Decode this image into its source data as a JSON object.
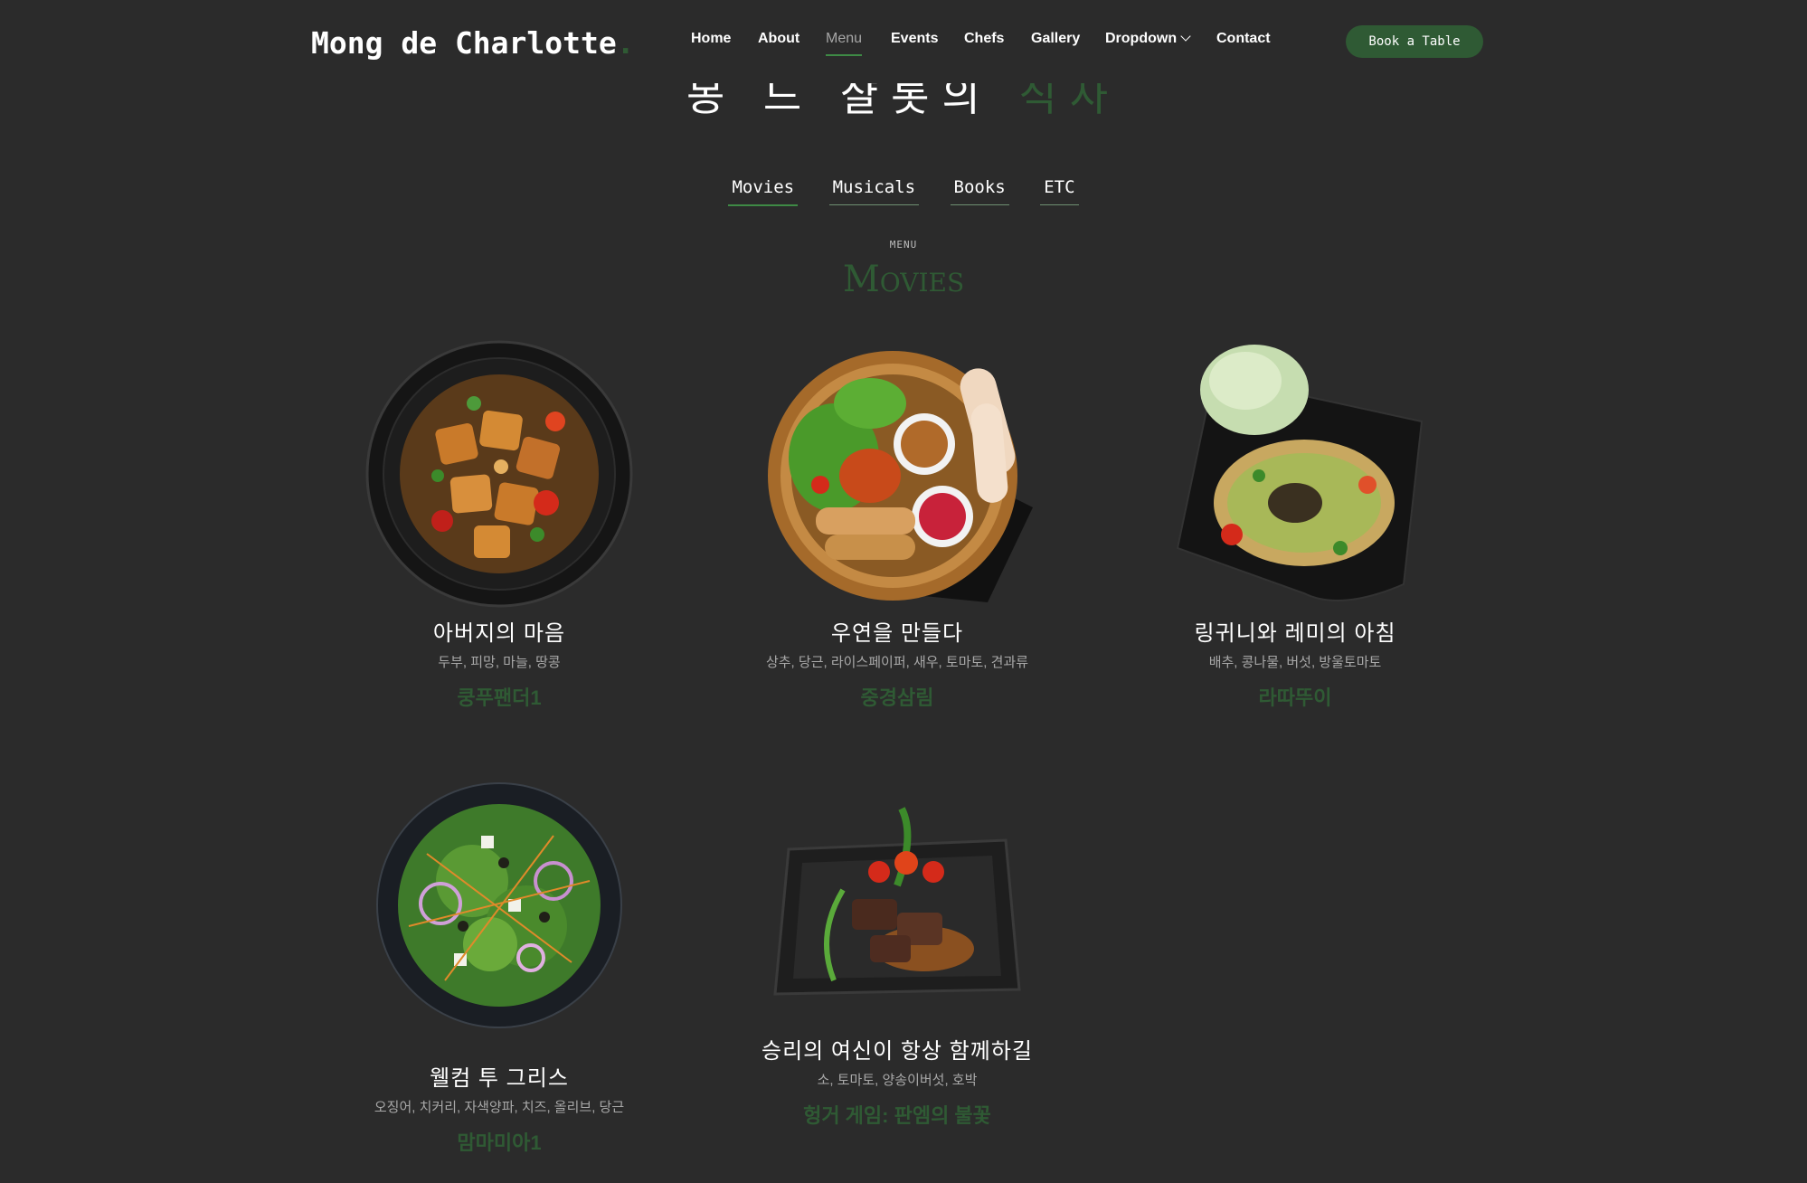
{
  "header": {
    "logo": "Mong de Charlotte",
    "logo_dot": ".",
    "nav": [
      {
        "label": "Home"
      },
      {
        "label": "About"
      },
      {
        "label": "Menu"
      },
      {
        "label": "Events"
      },
      {
        "label": "Chefs"
      },
      {
        "label": "Gallery"
      },
      {
        "label": "Dropdown"
      },
      {
        "label": "Contact"
      }
    ],
    "book_button": "Book a Table"
  },
  "hero": {
    "title_main": "몽 드 샬롯의 ",
    "title_accent": "식사"
  },
  "tabs": [
    "Movies",
    "Musicals",
    "Books",
    "ETC"
  ],
  "section": {
    "sub": "MENU",
    "title": "Movies"
  },
  "items": [
    {
      "name": "아버지의 마음",
      "ingredients": "두부, 피망, 마늘, 땅콩",
      "price": "쿵푸팬더1"
    },
    {
      "name": "우연을 만들다",
      "ingredients": "상추, 당근, 라이스페이퍼, 새우, 토마토, 견과류",
      "price": "중경삼림"
    },
    {
      "name": "링귀니와 레미의 아침",
      "ingredients": "배추, 콩나물, 버섯, 방울토마토",
      "price": "라따뚜이"
    },
    {
      "name": "웰컴 투 그리스",
      "ingredients": "오징어, 치커리, 자색양파, 치즈, 올리브, 당근",
      "price": "맘마미아1"
    },
    {
      "name": "승리의 여신이 항상 함께하길",
      "ingredients": "소, 토마토, 양송이버섯, 호박",
      "price": "헝거 게임: 판엠의 불꽃"
    }
  ]
}
